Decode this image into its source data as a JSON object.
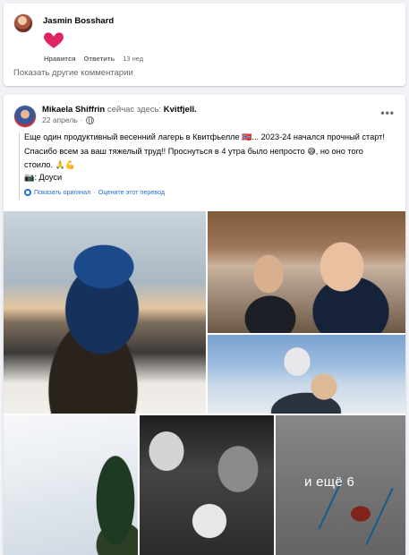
{
  "comment": {
    "author": "Jasmin Bosshard",
    "reaction_icon": "heart-icon",
    "reaction_color": "#e0245e",
    "actions": {
      "like": "Нравится",
      "reply": "Ответить",
      "time": "13 нед"
    },
    "more_comments": "Показать другие комментарии"
  },
  "post": {
    "author": "Mikaela Shiffrin",
    "here_text": "сейчас здесь:",
    "location": "Kvitfjell.",
    "date": "22 апрель",
    "privacy_icon": "globe-icon",
    "menu_icon": "more-options-icon",
    "text_part1": "Еще один продуктивный весенний лагерь в Квитфьелле",
    "text_flag": "🇳🇴",
    "text_part2": "... 2023-24 начался прочный старт! Спасибо всем за ваш тяжелый труд!! Проснуться в 4 утра было непросто",
    "text_emoji1": "😅",
    "text_part3": ", но оно того стоило.",
    "text_emoji2": "🙏💪",
    "camera_icon": "📷",
    "photo_credit": ": Доуси",
    "translate": {
      "show_original": "Показать оригинал",
      "separator": "·",
      "rate": "Оцените этот перевод"
    },
    "accent_color": "#216fdb",
    "more_photos": "и ещё 6"
  }
}
